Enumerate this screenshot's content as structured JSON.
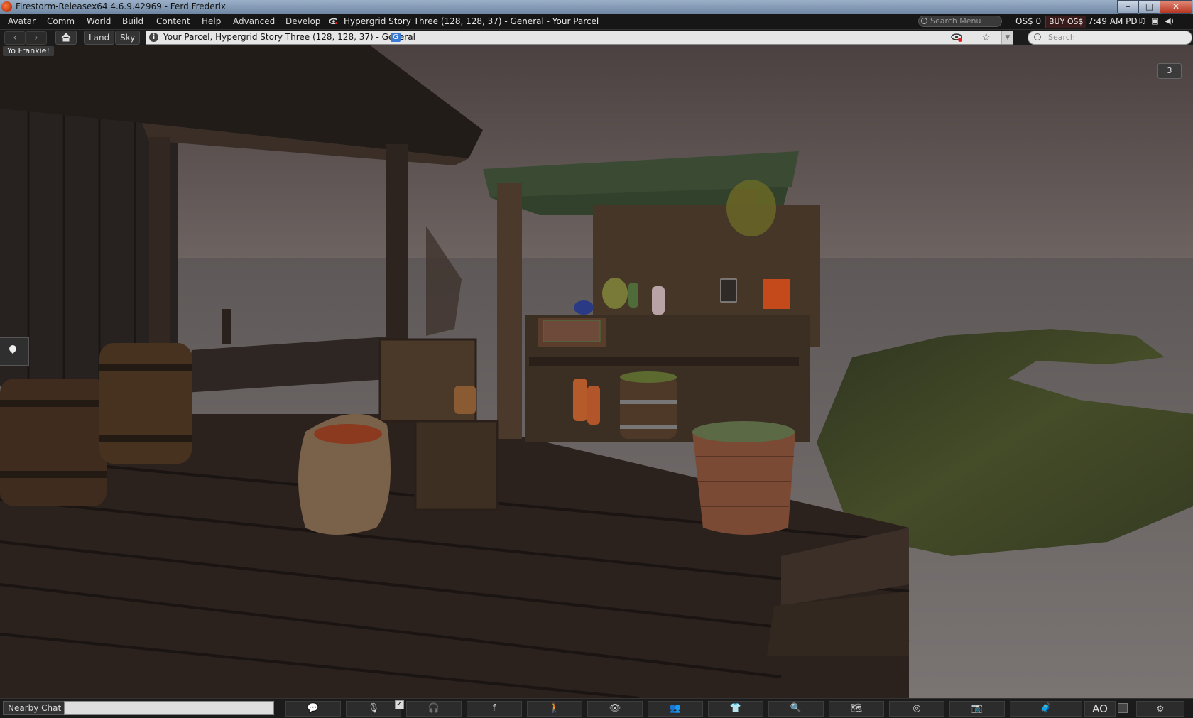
{
  "window": {
    "title": "Firestorm-Releasex64 4.6.9.42969 - Ferd Frederix",
    "controls": {
      "minimize": "–",
      "maximize": "□",
      "close": "✕"
    }
  },
  "menubar": {
    "items": [
      "Avatar",
      "Comm",
      "World",
      "Build",
      "Content",
      "Help",
      "Advanced",
      "Develop"
    ],
    "location": "Hypergrid Story Three (128, 128, 37) - General - Your Parcel",
    "search_menu_placeholder": "Search Menu",
    "currency": "OS$ 0",
    "buy_label": "BUY OS$",
    "clock": "7:49 AM PDT",
    "status_icons": [
      "music-icon",
      "media-icon",
      "volume-icon"
    ]
  },
  "navbar": {
    "back_icon": "‹",
    "forward_icon": "›",
    "home_icon": "home-icon",
    "land_label": "Land",
    "sky_label": "Sky",
    "location_text": "Your Parcel, Hypergrid Story Three (128, 128, 37) - General",
    "info_glyph": "i",
    "g_badge": "G",
    "search_placeholder": "Search"
  },
  "scene": {
    "greeting": "Yo Frankie!",
    "count_badge": "3"
  },
  "bottombar": {
    "nearby_chat_label": "Nearby Chat",
    "chat_input_value": "",
    "buttons": [
      "chat-icon",
      "microphone-icon",
      "headphones-icon",
      "facebook-icon",
      "walk-icon",
      "eye-icon",
      "people-icon",
      "clothing-icon",
      "search-icon",
      "map-icon",
      "radar-icon",
      "camera-icon",
      "inventory-icon"
    ],
    "ao_label": "AO"
  },
  "colors": {
    "menubar_bg": "#161616",
    "sky": "#5e5250",
    "water": "#6c6563",
    "grass": "#3e4428",
    "wood": "#3a2c22"
  }
}
